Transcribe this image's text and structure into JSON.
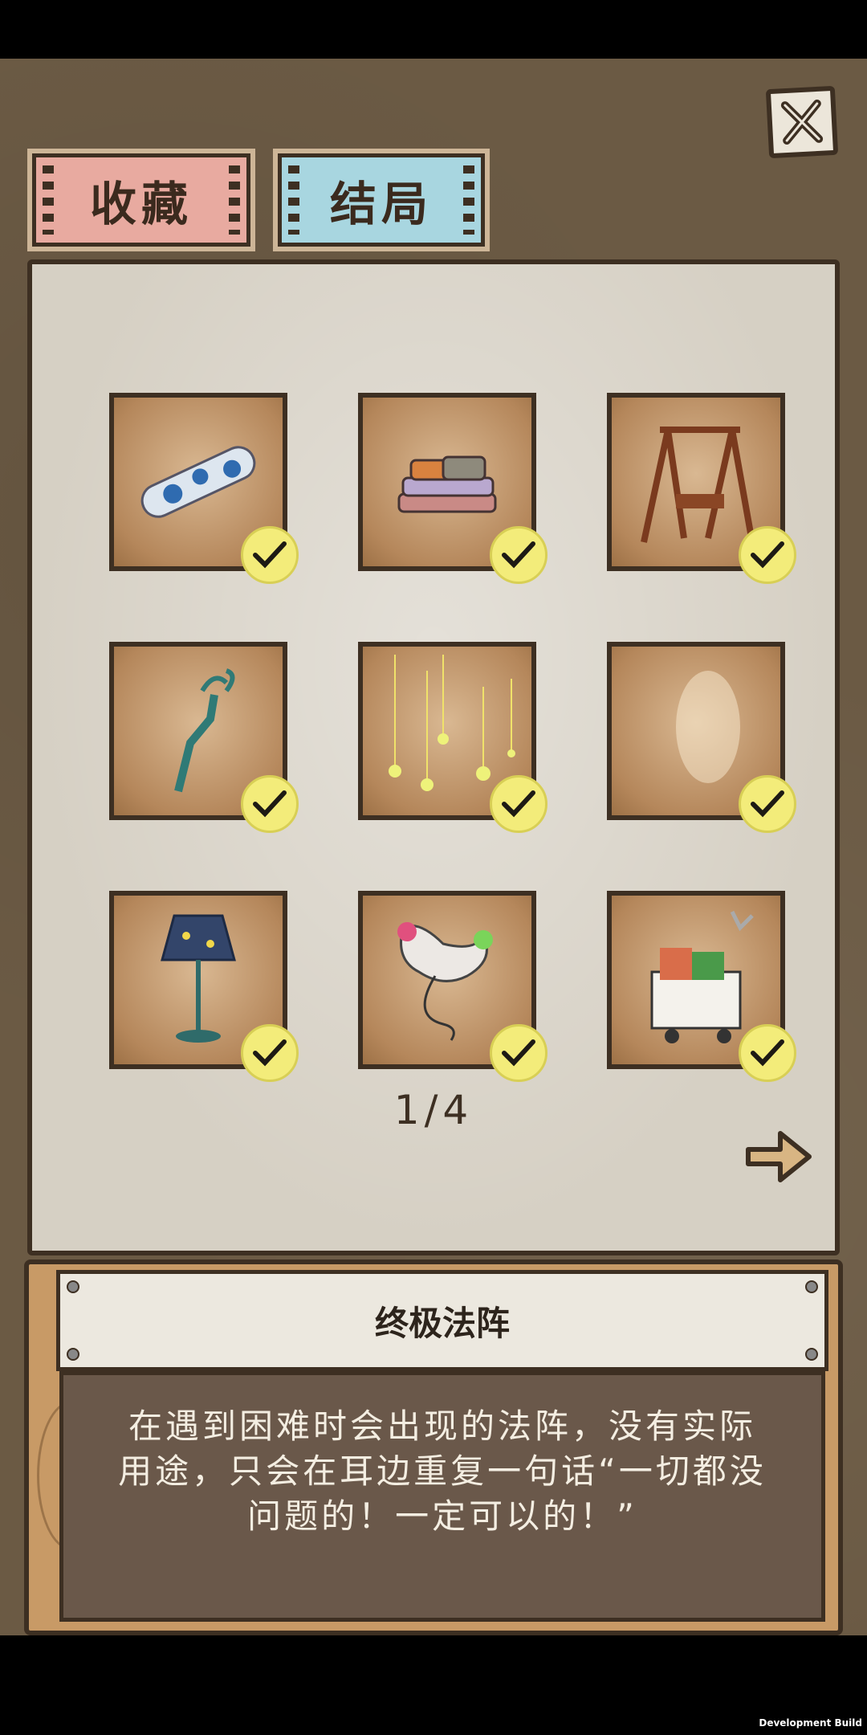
{
  "tabs": {
    "collect": "收藏",
    "ending": "结局"
  },
  "items": [
    {
      "icon": "dakimakura-pillow-icon",
      "checked": true
    },
    {
      "icon": "clothes-pile-icon",
      "checked": true
    },
    {
      "icon": "wooden-swing-icon",
      "checked": true
    },
    {
      "icon": "grabber-claw-icon",
      "checked": true
    },
    {
      "icon": "hanging-stars-icon",
      "checked": true
    },
    {
      "icon": "empty-item-icon",
      "checked": true
    },
    {
      "icon": "star-lamp-icon",
      "checked": true
    },
    {
      "icon": "game-controller-icon",
      "checked": true
    },
    {
      "icon": "shopping-cart-icon",
      "checked": true
    }
  ],
  "pagination": {
    "label": "1/4"
  },
  "detail": {
    "title": "终极法阵",
    "description": "在遇到困难时会出现的法阵，没有实际用途，只会在耳边重复一句话“一切都没问题的！一定可以的！”"
  },
  "footer": {
    "build_label": "Development Build"
  }
}
